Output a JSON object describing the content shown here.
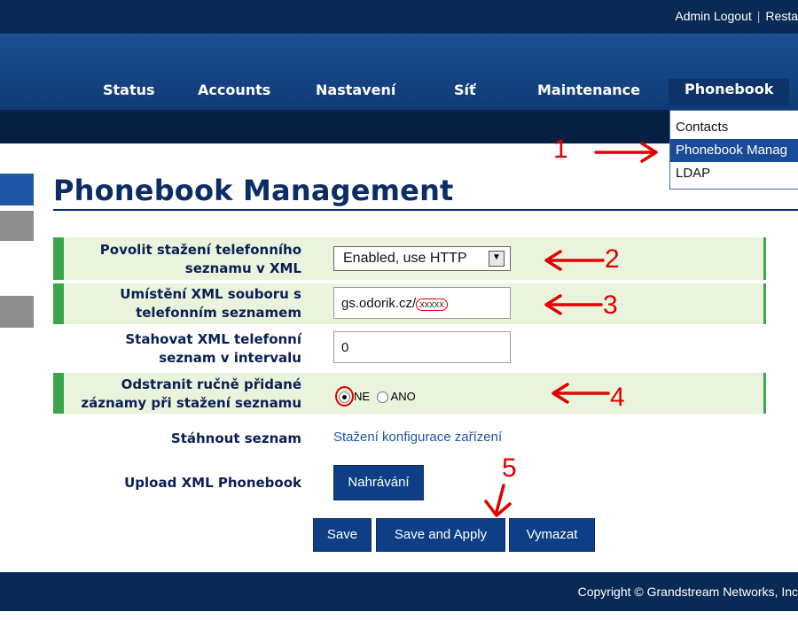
{
  "topbar": {
    "admin_logout": "Admin Logout",
    "separator": "|",
    "restart_partial": "Resta"
  },
  "nav": {
    "items": [
      {
        "label": "Status"
      },
      {
        "label": "Accounts"
      },
      {
        "label": "Nastavení"
      },
      {
        "label": "Síť"
      },
      {
        "label": "Maintenance"
      },
      {
        "label": "Phonebook",
        "active": true
      }
    ]
  },
  "dropdown": {
    "items": [
      {
        "label": "Contacts"
      },
      {
        "label": "Phonebook Manag",
        "selected": true
      },
      {
        "label": "LDAP"
      }
    ]
  },
  "page": {
    "title": "Phonebook Management"
  },
  "form": {
    "rows": [
      {
        "label_line1": "Povolit stažení telefonního",
        "label_line2": "seznamu v XML",
        "value": "Enabled, use HTTP"
      },
      {
        "label_line1": "Umístění XML souboru s",
        "label_line2": "telefonním seznamem",
        "value_prefix": "gs.odorik.cz/",
        "value_masked": "xxxxx"
      },
      {
        "label_line1": "Stahovat XML telefonní",
        "label_line2": "seznam v intervalu",
        "value": "0"
      },
      {
        "label_line1": "Odstranit ručně přidané",
        "label_line2": "záznamy při stažení seznamu",
        "option_no": "NE",
        "option_yes": "ANO",
        "selected": "NE"
      },
      {
        "label": "Stáhnout seznam",
        "link": "Stažení konfigurace zařízení"
      },
      {
        "label": "Upload XML Phonebook",
        "button": "Nahrávání"
      }
    ]
  },
  "actions": {
    "save": "Save",
    "save_apply": "Save and Apply",
    "reset": "Vymazat"
  },
  "footer": {
    "copyright": "Copyright © Grandstream Networks, Inc"
  },
  "annotations": {
    "n1": "1",
    "n2": "2",
    "n3": "3",
    "n4": "4",
    "n5": "5",
    "color": "#e00000"
  }
}
